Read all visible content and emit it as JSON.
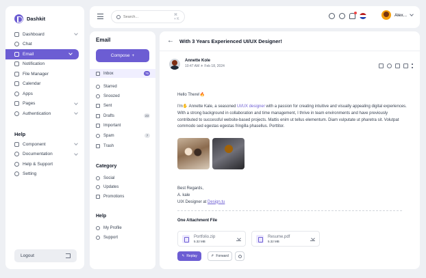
{
  "app": {
    "name": "Dashkit"
  },
  "sidebar": {
    "items": [
      {
        "label": "Dashboard",
        "icon": "dashboard-icon",
        "chevron": true
      },
      {
        "label": "Chat",
        "icon": "chat-icon",
        "chevron": false
      },
      {
        "label": "Email",
        "icon": "mail-icon",
        "chevron": true,
        "active": true
      },
      {
        "label": "Notification",
        "icon": "bell-icon",
        "chevron": false
      },
      {
        "label": "File Manager",
        "icon": "folder-icon",
        "chevron": false
      },
      {
        "label": "Calendar",
        "icon": "calendar-icon",
        "chevron": false
      },
      {
        "label": "Apps",
        "icon": "apps-icon",
        "chevron": false
      },
      {
        "label": "Pages",
        "icon": "pages-icon",
        "chevron": true
      },
      {
        "label": "Authentication",
        "icon": "lock-icon",
        "chevron": true
      }
    ],
    "help_title": "Help",
    "help_items": [
      {
        "label": "Component",
        "icon": "component-icon",
        "chevron": true
      },
      {
        "label": "Documentation",
        "icon": "document-icon",
        "chevron": true
      },
      {
        "label": "Help & Support",
        "icon": "headset-icon",
        "chevron": false
      },
      {
        "label": "Setting",
        "icon": "gear-icon",
        "chevron": false
      }
    ],
    "logout_label": "Logout"
  },
  "header": {
    "search_placeholder": "Search...",
    "search_shortcut": "⌘ + K",
    "user_name": "Alex..."
  },
  "email_nav": {
    "title": "Email",
    "compose_label": "Compose",
    "compose_icon": "+",
    "folders": [
      {
        "label": "Inbox",
        "icon": "inbox-icon",
        "badge": "76",
        "active": true
      },
      {
        "label": "Starred",
        "icon": "star-icon"
      },
      {
        "label": "Snoozed",
        "icon": "clock-icon"
      },
      {
        "label": "Sent",
        "icon": "send-icon"
      },
      {
        "label": "Drafts",
        "icon": "draft-icon",
        "badge": "23"
      },
      {
        "label": "Important",
        "icon": "bookmark-icon"
      },
      {
        "label": "Spam",
        "icon": "spam-icon",
        "badge": "7"
      },
      {
        "label": "Trash",
        "icon": "trash-icon"
      }
    ],
    "category_title": "Category",
    "categories": [
      {
        "label": "Social",
        "icon": "social-icon"
      },
      {
        "label": "Updates",
        "icon": "updates-icon"
      },
      {
        "label": "Promotions",
        "icon": "tag-icon"
      }
    ],
    "help_title": "Help",
    "help": [
      {
        "label": "My Profile",
        "icon": "user-icon"
      },
      {
        "label": "Support",
        "icon": "headset-icon"
      }
    ]
  },
  "message": {
    "subject": "With 3 Years Experienced UI/UX Designer!",
    "sender_name": "Annette Kole",
    "time": "10:47 AM",
    "date": "Feb 18, 2024",
    "greeting": "Hello There!🔥",
    "para_lead": "I'm✋ Annette Kale, a seasoned ",
    "para_link": "UI/UX designer",
    "para_rest": " with a passion for creating intuitive and visually appealing digital experiences. With a strong background in collaboration and time management, I thrive in team environments and have previously contributed to successful website-based projects. Mattis enim ut tellus elementum. Diam vulputate ut pharetra sit. Volutpat commodo sed egestas egestas fringilla phasellus. Porttitor.",
    "regards": "Best Regards,",
    "sign_name": "A. kale",
    "sign_role": "UIX Designer at ",
    "sign_link": "Design.tu",
    "attach_title": "One Attachment File",
    "files": [
      {
        "name": "Portfolio.zip",
        "size": "5.32 MB"
      },
      {
        "name": "Resume.pdf",
        "size": "5.32 MB"
      }
    ],
    "reply_label": "Replay",
    "forward_label": "Forward"
  }
}
